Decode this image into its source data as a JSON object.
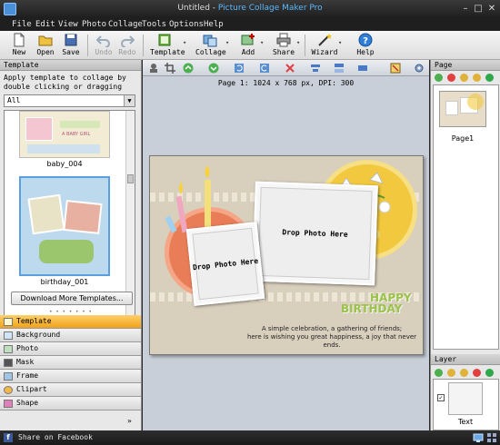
{
  "window": {
    "doc_title": "Untitled",
    "separator": " - ",
    "product": "Picture Collage Maker Pro"
  },
  "menu": [
    "File",
    "Edit",
    "View",
    "Photo",
    "Collage",
    "Tools",
    "Options",
    "Help"
  ],
  "toolbar": {
    "new": "New",
    "open": "Open",
    "save": "Save",
    "undo": "Undo",
    "redo": "Redo",
    "template": "Template",
    "collage": "Collage",
    "add": "Add",
    "share": "Share",
    "wizard": "Wizard",
    "help": "Help"
  },
  "left_panel": {
    "header": "Template",
    "instructions": "Apply template to collage by double clicking or dragging",
    "filter_value": "All",
    "templates": [
      {
        "name": "baby_004"
      },
      {
        "name": "birthday_001"
      }
    ],
    "baby_card_text": "A BABY GIRL",
    "download_button": "Download More Templates...",
    "tabs": [
      "Template",
      "Background",
      "Photo",
      "Mask",
      "Frame",
      "Clipart",
      "Shape"
    ],
    "more": "»"
  },
  "canvas": {
    "page_info": "Page 1: 1024 x 768 px, DPI: 300",
    "drop_left": "Drop Photo Here",
    "drop_right": "Drop Photo Here",
    "happy": "HAPPY",
    "birthday": "BIRTHDAY",
    "greeting_line1": "A simple celebration, a gathering of friends;",
    "greeting_line2": "here is wishing you great happiness, a joy that never ends."
  },
  "right_panel": {
    "page_header": "Page",
    "page_label": "Page1",
    "layer_header": "Layer",
    "layer_label": "Text",
    "layer_checked": "✓"
  },
  "status": {
    "facebook": "Share on Facebook"
  },
  "colors": {
    "accent": "#f0a21a",
    "brand": "#58b9ff",
    "facebook": "#3b5998",
    "happy_green": "#9bc24a"
  }
}
